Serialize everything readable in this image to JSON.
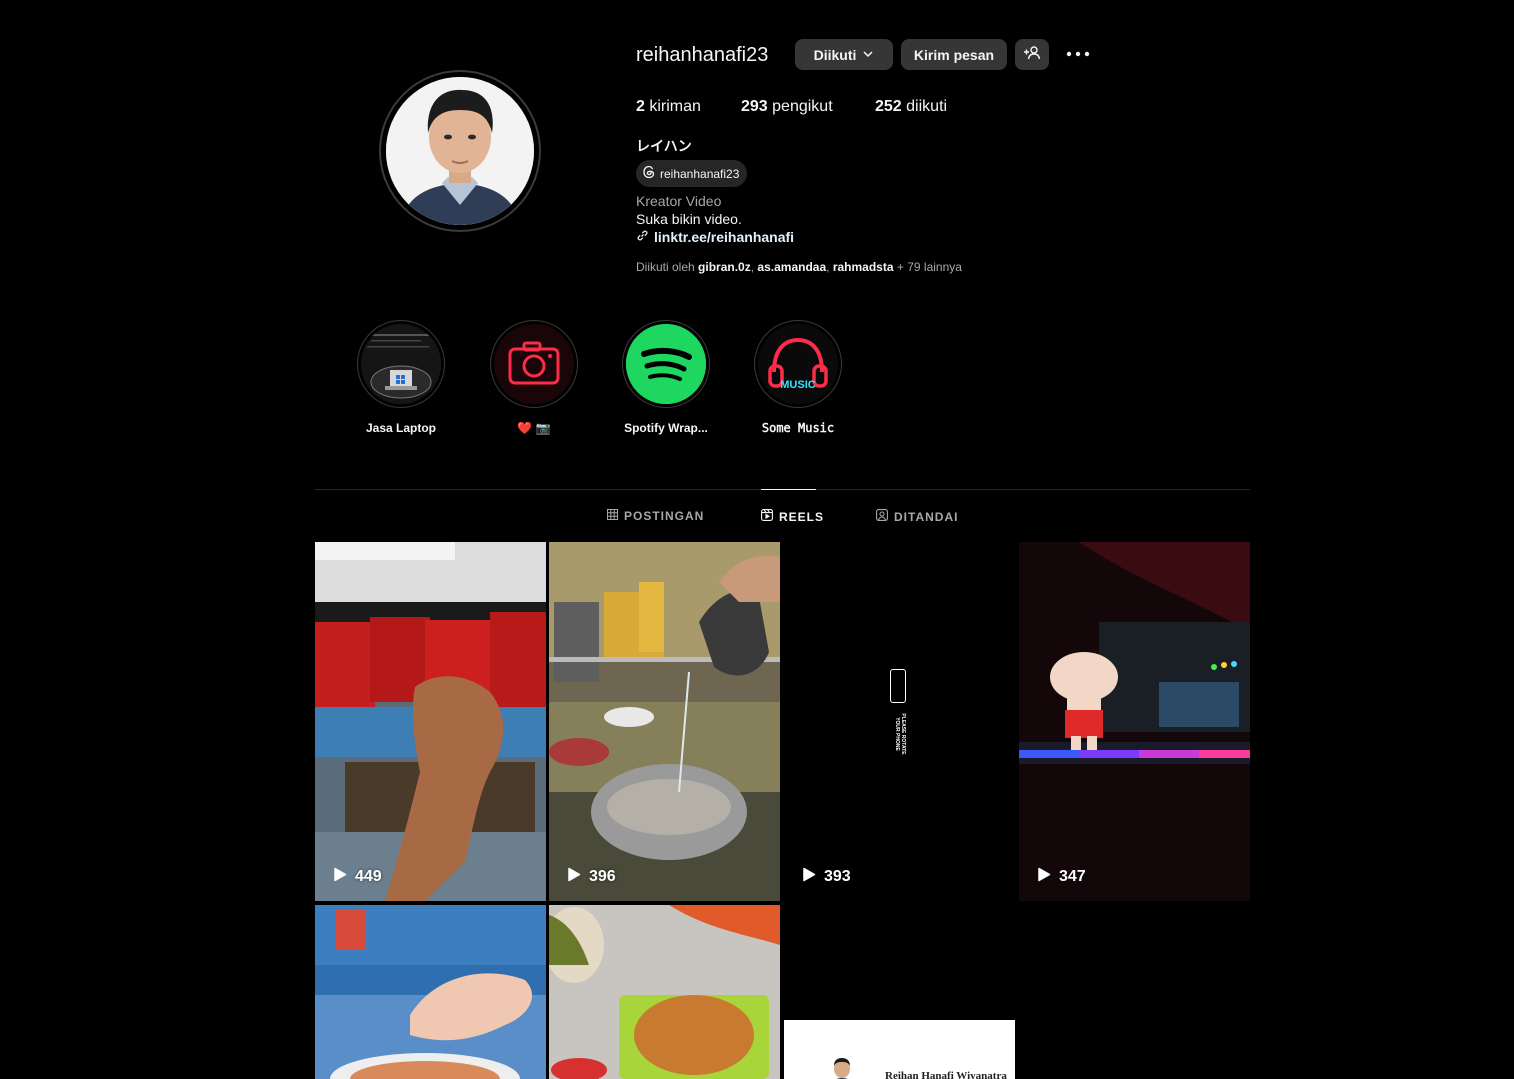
{
  "profile": {
    "username": "reihanhanafi23",
    "buttons": {
      "following": "Diikuti",
      "message": "Kirim pesan"
    },
    "stats": {
      "posts_count": "2",
      "posts_label": "kiriman",
      "followers_count": "293",
      "followers_label": "pengikut",
      "following_count": "252",
      "following_label": "diikuti"
    },
    "full_name": "レイハン",
    "threads_handle": "reihanhanafi23",
    "category": "Kreator Video",
    "bio": "Suka bikin video.",
    "link": "linktr.ee/reihanhanafi",
    "followed_by": {
      "prefix": "Diikuti oleh",
      "users": [
        "gibran.0z",
        "as.amandaa",
        "rahmadsta"
      ],
      "sep1": ",",
      "sep2": ",",
      "more": "+ 79 lainnya"
    }
  },
  "highlights": [
    {
      "label": "Jasa Laptop",
      "icon": "laptop-icon"
    },
    {
      "label": "❤️ 📷",
      "icon": "camera-icon"
    },
    {
      "label": "Spotify Wrap...",
      "icon": "spotify-icon"
    },
    {
      "label": "𝚂𝚘𝚖𝚎 𝙼𝚞𝚜𝚒𝚌",
      "icon": "headphones-icon",
      "neon_text": "MUSIC"
    }
  ],
  "tabs": [
    {
      "label": "POSTINGAN",
      "icon": "grid-icon",
      "active": false
    },
    {
      "label": "REELS",
      "icon": "reels-icon",
      "active": true
    },
    {
      "label": "DITANDAI",
      "icon": "tagged-icon",
      "active": false
    }
  ],
  "reels": [
    {
      "views": "449",
      "icon": "play-icon"
    },
    {
      "views": "396",
      "icon": "play-icon"
    },
    {
      "views": "393",
      "icon": "play-icon",
      "overlay_text": "PLEASE ROTATE YOUR PHONE"
    },
    {
      "views": "347",
      "icon": "play-icon"
    },
    {
      "views": ""
    },
    {
      "views": ""
    },
    {
      "views": "",
      "doc_name": "Reihan Hanafi Wiyanatra"
    }
  ],
  "colors": {
    "background": "#000000",
    "button": "#363636",
    "secondary_text": "#a8a8a8",
    "spotify": "#1ed760",
    "neon_red": "#ff2b4a",
    "neon_cyan": "#36e3ff"
  }
}
